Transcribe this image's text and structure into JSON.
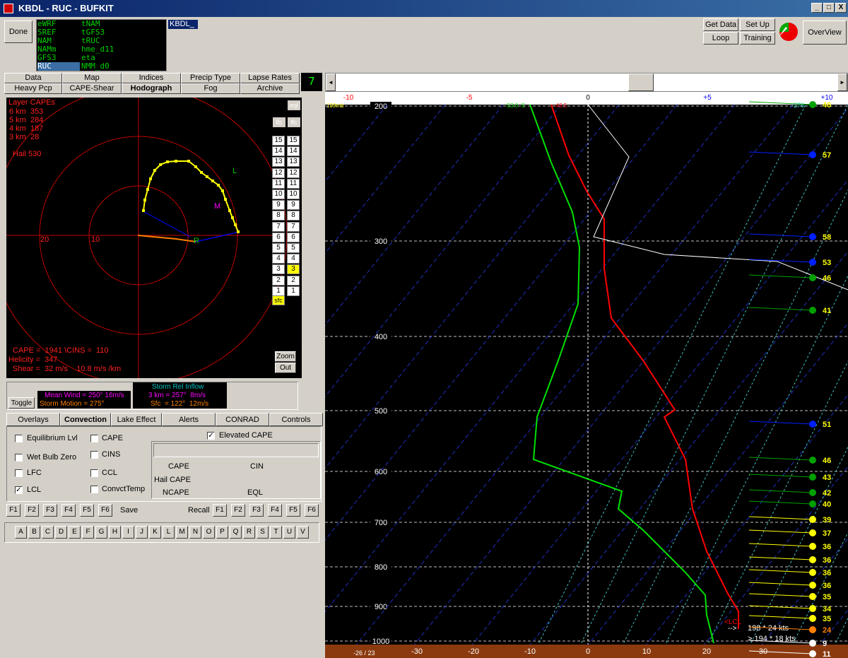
{
  "window": {
    "title": "KBDL - RUC - BUFKIT",
    "min": "_",
    "max": "□",
    "close": "X"
  },
  "toolbar": {
    "done": "Done",
    "get_data": "Get Data",
    "set_up": "Set Up",
    "loop": "Loop",
    "training": "Training",
    "overview": "OverView"
  },
  "models": {
    "col1": [
      "eWRF",
      "SREF",
      "NAM",
      "NAMm",
      "GFS3",
      "RUC"
    ],
    "col2": [
      "tNAM",
      "tGFS3",
      "tRUC",
      "hme_d11",
      "eta",
      "NMM_d0"
    ],
    "selected": "RUC"
  },
  "station": "KBDL_",
  "tabs_row1": [
    "Data",
    "Map",
    "Indices",
    "Precip Type",
    "Lapse Rates"
  ],
  "tabs_row2": [
    "Heavy Pcp",
    "CAPE-Shear",
    "Hodograph",
    "Fog",
    "Archive"
  ],
  "active_tab": "Hodograph",
  "frame_number": "7",
  "scroll": {
    "left": "◄",
    "right": "►"
  },
  "hodograph": {
    "layer_capes_title": "Layer CAPEs",
    "layer_capes": [
      "6 km  353",
      "5 km  284",
      "4 km  187",
      "3 km  28"
    ],
    "hail": "Hail  530",
    "ring_labels": [
      "20",
      "10"
    ],
    "marker_L": "L",
    "marker_M": "M",
    "marker_R": "R",
    "cape_line": "CAPE =  1941 \\CINS =  110",
    "helicity": "Helicity =  347",
    "shear": "Shear =  32 m/s    10.8 m/s /km",
    "eql": "eql",
    "lfc1": "lfc",
    "lfc2": "lfc",
    "levels": [
      "15",
      "14",
      "13",
      "12",
      "11",
      "10",
      "9",
      "8",
      "7",
      "6",
      "5",
      "4",
      "3",
      "2",
      "1"
    ],
    "highlight_level": "3",
    "sfc": "sfc",
    "zoom": "Zoom",
    "out": "Out"
  },
  "wind_panel": {
    "toggle": "Toggle",
    "mean_wind": "Mean Wind = 250°  16m/s",
    "storm_motion": "Storm Motion = 275°",
    "sri_title": "Storm Rel Inflow",
    "sri_3km": "3 km = 257°  8m/s",
    "sri_sfc": "Sfc  = 122°  12m/s"
  },
  "lower_tabs": [
    "Overlays",
    "Convection",
    "Lake Effect",
    "Alerts",
    "CONRAD",
    "Controls"
  ],
  "active_lower_tab": "Convection",
  "convection": {
    "checkboxes_left": [
      {
        "label": "Equilibrium Lvl",
        "checked": false
      },
      {
        "label": "Wet Bulb Zero",
        "checked": false
      },
      {
        "label": "LFC",
        "checked": false
      },
      {
        "label": "LCL",
        "checked": true
      }
    ],
    "checkboxes_right": [
      {
        "label": "CAPE",
        "checked": false
      },
      {
        "label": "CINS",
        "checked": false
      },
      {
        "label": "CCL",
        "checked": false
      },
      {
        "label": "ConvctTemp",
        "checked": false
      }
    ],
    "elevated_cape": {
      "label": "Elevated CAPE",
      "checked": true
    },
    "grid_labels": [
      "CAPE",
      "CIN",
      "Hail CAPE",
      "NCAPE",
      "EQL"
    ]
  },
  "fkeys": {
    "left": [
      "F1",
      "F2",
      "F3",
      "F4",
      "F5",
      "F6"
    ],
    "save": "Save",
    "recall": "Recall",
    "right": [
      "F1",
      "F2",
      "F3",
      "F4",
      "F5",
      "F6"
    ]
  },
  "letters": [
    "A",
    "B",
    "C",
    "D",
    "E",
    "F",
    "G",
    "H",
    "I",
    "J",
    "K",
    "L",
    "M",
    "N",
    "O",
    "P",
    "Q",
    "R",
    "S",
    "T",
    "U",
    "V"
  ],
  "sounding": {
    "top_axis": [
      "-10",
      "-5",
      "0",
      "+5",
      "+10"
    ],
    "pressure_levels": [
      "200",
      "300",
      "400",
      "500",
      "600",
      "700",
      "800",
      "900",
      "1000"
    ],
    "temp_axis": [
      "-30",
      "-20",
      "-10",
      "0",
      "10",
      "20",
      "30"
    ],
    "top_left_label": "199mb",
    "top_left2": "-53.0 -5",
    "top_left3": "~48.5",
    "top_right_label": "-276",
    "lcl": "LCL",
    "wind_readout1": "198 * 24 kts",
    "wind_readout2": "194 * 18 kts",
    "bottom_left": "-26 / 23",
    "wind_speeds": [
      "46",
      "57",
      "58",
      "53",
      "46",
      "41",
      "51",
      "46",
      "43",
      "42",
      "40",
      "39",
      "37",
      "36",
      "36",
      "36",
      "36",
      "35",
      "34",
      "35",
      "24",
      "9",
      "11"
    ],
    "colors": {
      "temp": "#ff0000",
      "dewpoint": "#00e000",
      "background": "#000000",
      "ground": "#8b3a0f"
    }
  }
}
